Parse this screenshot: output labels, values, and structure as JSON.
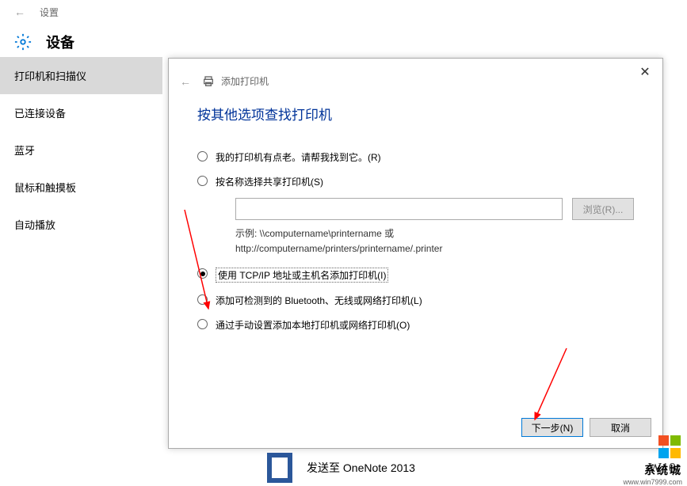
{
  "header": {
    "settings_label": "设置"
  },
  "device": {
    "title": "设备"
  },
  "sidebar": {
    "items": [
      {
        "label": "打印机和扫描仪"
      },
      {
        "label": "已连接设备"
      },
      {
        "label": "蓝牙"
      },
      {
        "label": "鼠标和触摸板"
      },
      {
        "label": "自动播放"
      }
    ]
  },
  "dialog": {
    "title": "添加打印机",
    "heading": "按其他选项查找打印机",
    "options": {
      "old_printer": "我的打印机有点老。请帮我找到它。(R)",
      "by_name": "按名称选择共享打印机(S)",
      "by_tcpip": "使用 TCP/IP 地址或主机名添加打印机(I)",
      "bluetooth": "添加可检测到的 Bluetooth、无线或网络打印机(L)",
      "manual": "通过手动设置添加本地打印机或网络打印机(O)"
    },
    "browse_btn": "浏览(R)...",
    "example_prefix": "示例: ",
    "example_line1": "\\\\computername\\printername 或",
    "example_line2": "http://computername/printers/printername/.printer",
    "next_btn": "下一步(N)",
    "cancel_btn": "取消"
  },
  "onenote": {
    "label": "发送至 OneNote 2013"
  },
  "watermark": {
    "title": "系统城",
    "url": "www.win7999.com"
  },
  "w10_label": "W10"
}
